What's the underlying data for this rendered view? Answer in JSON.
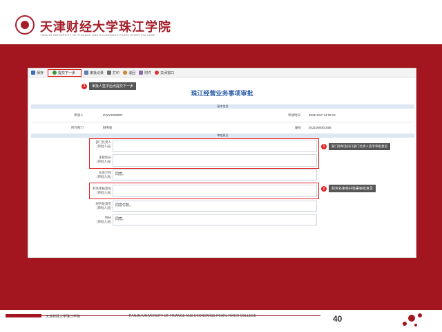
{
  "header": {
    "school_name_cn": "天津财经大学珠江学院",
    "school_name_en": "TIANJIN UNIVERSITY OF FINANCE AND ECONOMICS PEARL RIVER COLLEGE"
  },
  "toolbar": {
    "items": [
      {
        "label": "保存",
        "icon": "save-icon"
      },
      {
        "label": "提交下一步",
        "icon": "next-step-icon"
      },
      {
        "label": "审批记录",
        "icon": "record-icon"
      },
      {
        "label": "打印",
        "icon": "print-icon"
      },
      {
        "label": "退回",
        "icon": "return-icon"
      },
      {
        "label": "附件",
        "icon": "attachment-icon"
      },
      {
        "label": "关闭窗口",
        "icon": "close-icon"
      }
    ]
  },
  "callouts": {
    "one": {
      "num": "3",
      "text": "审批人签字后点提交下一步"
    },
    "two": {
      "num": "1",
      "text": "部门领导及归口部门负责人签字审批意见"
    },
    "three": {
      "num": "2",
      "text": "财务处审核并签署审批意见"
    }
  },
  "form": {
    "title": "珠江经营业务事项审批",
    "section_basic": "基本信息",
    "section_approval": "审批意见",
    "basic_rows": [
      {
        "label": "申请人",
        "value": "ZJXY2000097",
        "label2": "申请时间",
        "value2": "2021/4/27 14:30:12"
      },
      {
        "label": "所在部门",
        "value": "财务处",
        "label2": "编号",
        "value2": "2021000001555"
      }
    ],
    "approval_rows": [
      {
        "label": "部门负责人\n(审批人员)",
        "value": ""
      },
      {
        "label": "主管校长\n(审批人员)",
        "value": ""
      },
      {
        "label": "总会计师\n(审批人员)",
        "value": "同意。"
      },
      {
        "label": "财务审核意见\n(审批人员)",
        "value": ""
      },
      {
        "label": "财务处意见\n(审批人员)",
        "value": "同意付款。"
      },
      {
        "label": "院长\n(审批人员)",
        "value": "同意。"
      }
    ]
  },
  "footer": {
    "cn": "天津财经大学珠江学院",
    "en": "TIANJIN UNIVERSITY OF FINANCE AND ECONOMICS PEARL RIVER COLLEGE",
    "page": "40"
  },
  "colors": {
    "brand_red": "#a3161f",
    "highlight_red": "#e02020",
    "title_blue": "#2a5caa"
  }
}
